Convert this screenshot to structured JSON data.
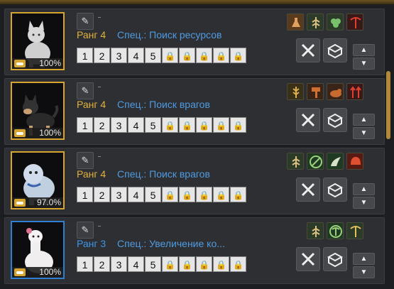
{
  "pets": [
    {
      "name": "",
      "rank": "Ранг 4",
      "spec": "Спец.: Поиск ресурсов",
      "loyalty": "100%",
      "skills": [
        "potion-skill-icon",
        "fern-skill-icon",
        "clover-skill-icon",
        "pickaxe-skill-icon"
      ]
    },
    {
      "name": "",
      "rank": "Ранг 4",
      "spec": "Спец.: Поиск врагов",
      "loyalty": "100%",
      "skills": [
        "wheat-skill-icon",
        "hammer-skill-icon",
        "bird-skill-icon",
        "arrows-skill-icon"
      ]
    },
    {
      "name": "",
      "rank": "Ранг 4",
      "spec": "Спец.: Поиск врагов",
      "loyalty": "97.0%",
      "skills": [
        "fern-skill-icon",
        "sickle-skill-icon",
        "wing-skill-icon",
        "helmet-skill-icon"
      ]
    },
    {
      "name": "",
      "rank": "Ранг 3",
      "spec": "Спец.: Увеличение ко...",
      "loyalty": "100%",
      "skills": [
        "fern-skill-icon",
        "pickaxe-skill-icon",
        "pickaxe-skill-icon"
      ]
    }
  ],
  "slots": [
    "1",
    "2",
    "3",
    "4",
    "5"
  ],
  "lock_glyph": "🔒",
  "edit_glyph": "✎",
  "arrow_up": "▲",
  "arrow_down": "▼",
  "colors": {
    "rank_gold": "#e2b23c",
    "rank_blue": "#3d95e6",
    "spec": "#4f9be0",
    "frame_gold": "#d6a531",
    "frame_blue": "#2e7fd0"
  }
}
